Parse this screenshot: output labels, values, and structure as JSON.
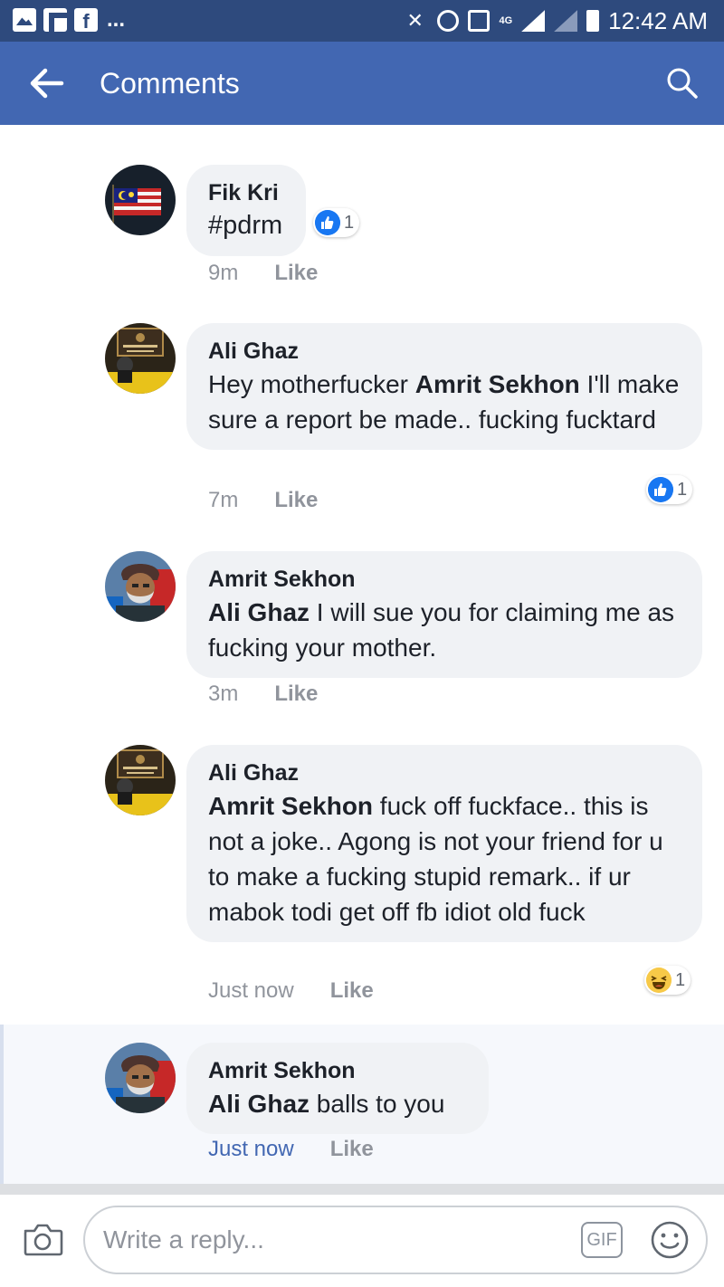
{
  "status_bar": {
    "time": "12:42 AM",
    "more": "...",
    "network": "4G",
    "icons": [
      "gallery-icon",
      "flipboard-icon",
      "facebook-icon",
      "mute-icon",
      "alarm-icon",
      "nfc-icon",
      "signal-icon",
      "battery-icon"
    ]
  },
  "app_bar": {
    "title": "Comments",
    "back_icon": "arrow-left-icon",
    "search_icon": "search-icon",
    "color": "#4267b2"
  },
  "comments": [
    {
      "author": "Fik Kri",
      "mention": "",
      "text": "#pdrm",
      "time": "9m",
      "like_label": "Like",
      "reaction": {
        "type": "like",
        "count": "1"
      }
    },
    {
      "author": "Ali Ghaz",
      "text_before": "Hey motherfucker ",
      "mention": "Amrit Sekhon",
      "text_after": " I'll make sure a report be made.. fucking fucktard",
      "time": "7m",
      "like_label": "Like",
      "reaction": {
        "type": "like",
        "count": "1"
      }
    },
    {
      "author": "Amrit Sekhon",
      "mention": "Ali Ghaz",
      "text": " I will sue you for claiming me as fucking your mother.",
      "time": "3m",
      "like_label": "Like"
    },
    {
      "author": "Ali Ghaz",
      "mention": "Amrit Sekhon",
      "text": " fuck off fuckface.. this is not a joke.. Agong is not your friend for u to make a fucking stupid remark.. if ur mabok todi get off fb idiot old fuck",
      "time": "Just now",
      "like_label": "Like",
      "reaction": {
        "type": "haha",
        "count": "1"
      }
    },
    {
      "author": "Amrit Sekhon",
      "mention": "Ali Ghaz",
      "text": " balls to you",
      "time": "Just now",
      "like_label": "Like"
    }
  ],
  "reply_bar": {
    "placeholder": "Write a reply...",
    "gif_label": "GIF",
    "camera_icon": "camera-icon",
    "emoji_icon": "emoji-icon"
  },
  "colors": {
    "status_bar": "#2e4a7d",
    "app_bar": "#4267b2",
    "bubble": "#f0f2f5",
    "link": "#4267b2",
    "meta": "#90949c"
  }
}
